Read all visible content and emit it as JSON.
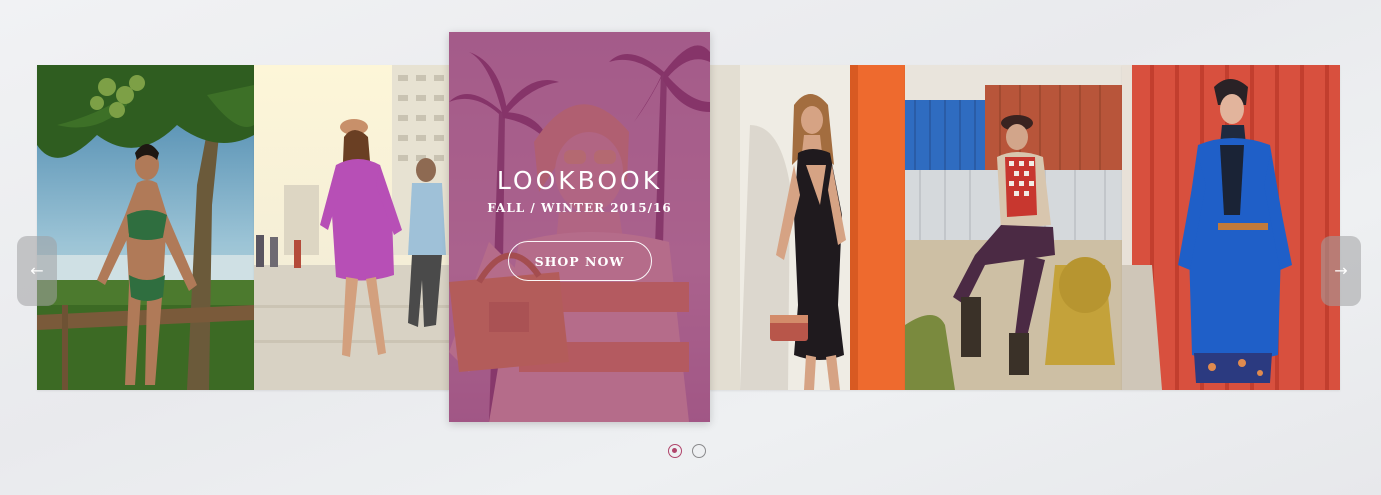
{
  "carousel": {
    "slides": [
      {
        "alt": "beach-swimwear-model"
      },
      {
        "alt": "street-pink-shirt-dress-model"
      },
      {
        "alt": "lookbook-featured-sunglasses-model"
      },
      {
        "alt": "black-dress-model"
      },
      {
        "alt": "containers-checkered-shirt-model"
      },
      {
        "alt": "blue-coat-model"
      }
    ],
    "feature": {
      "title": "LOOKBOOK",
      "subtitle": "FALL / WINTER 2015/16",
      "button_label": "SHOP NOW",
      "overlay_color": "#8e2d6e"
    },
    "prev_arrow": {
      "glyph": "←",
      "icon": "arrow-left-icon"
    },
    "next_arrow": {
      "glyph": "→",
      "icon": "arrow-right-icon"
    },
    "pagination": {
      "count": 2,
      "active_index": 0,
      "active_color": "#b0456b"
    }
  }
}
